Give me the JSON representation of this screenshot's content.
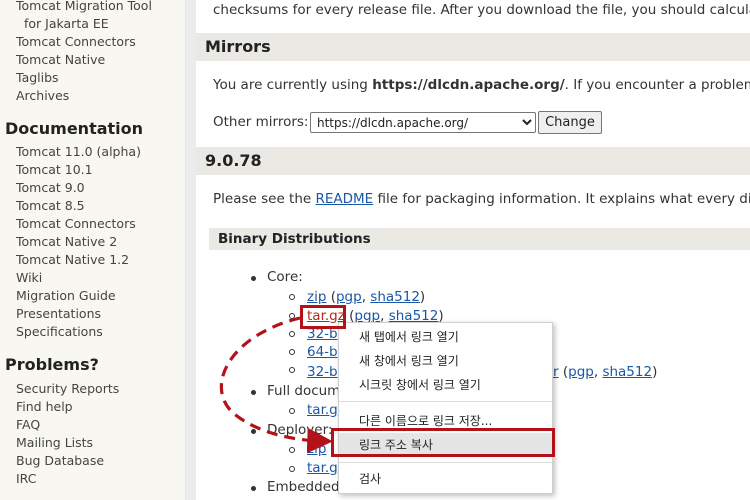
{
  "sidebar": {
    "links_top": [
      "Tomcat Migration Tool",
      "for Jakarta EE",
      "Tomcat Connectors",
      "Tomcat Native",
      "Taglibs",
      "Archives"
    ],
    "documentation_heading": "Documentation",
    "documentation_links": [
      "Tomcat 11.0 (alpha)",
      "Tomcat 10.1",
      "Tomcat 9.0",
      "Tomcat 8.5",
      "Tomcat Connectors",
      "Tomcat Native 2",
      "Tomcat Native 1.2",
      "Wiki",
      "Migration Guide",
      "Presentations",
      "Specifications"
    ],
    "problems_heading": "Problems?",
    "problems_links": [
      "Security Reports",
      "Find help",
      "FAQ",
      "Mailing Lists",
      "Bug Database",
      "IRC"
    ]
  },
  "main": {
    "intro_text": "checksums for every release file. After you download the file, you should calculate a",
    "mirrors_heading": "Mirrors",
    "mirror_text_pre": "You are currently using ",
    "mirror_url_bold": "https://dlcdn.apache.org/",
    "mirror_text_post": ". If you encounter a problem with",
    "other_mirrors_label": "Other mirrors:",
    "mirror_select_value": "https://dlcdn.apache.org/",
    "change_button": "Change",
    "version_heading": "9.0.78",
    "readme_pre": "Please see the ",
    "readme_link": "README",
    "readme_post": " file for packaging information. It explains what every distrib",
    "binary_heading": "Binary Distributions",
    "core_label": "Core:",
    "zip_link": "zip",
    "pgp": "pgp",
    "sha512": "sha512",
    "targz_link": "tar.gz",
    "trunc_32b": "32-b",
    "trunc_64b": "64-b",
    "trunc_32b_2": "32-b",
    "trunc_r": "r",
    "full_doc": "Full docum",
    "trunc_tar": "tar.g",
    "deployer": "Deployer:",
    "trunc_zip": "zip",
    "trunc_tar2": "tar.g",
    "embedded": "Embedded"
  },
  "context_menu": {
    "items": [
      "새 탭에서 링크 열기",
      "새 창에서 링크 열기",
      "시크릿 창에서 링크 열기",
      "다른 이름으로 링크 저장...",
      "링크 주소 복사",
      "검사"
    ]
  },
  "colors": {
    "annotation": "#b3121a",
    "link": "#1a57a6",
    "visited_link": "#b02a1c"
  }
}
